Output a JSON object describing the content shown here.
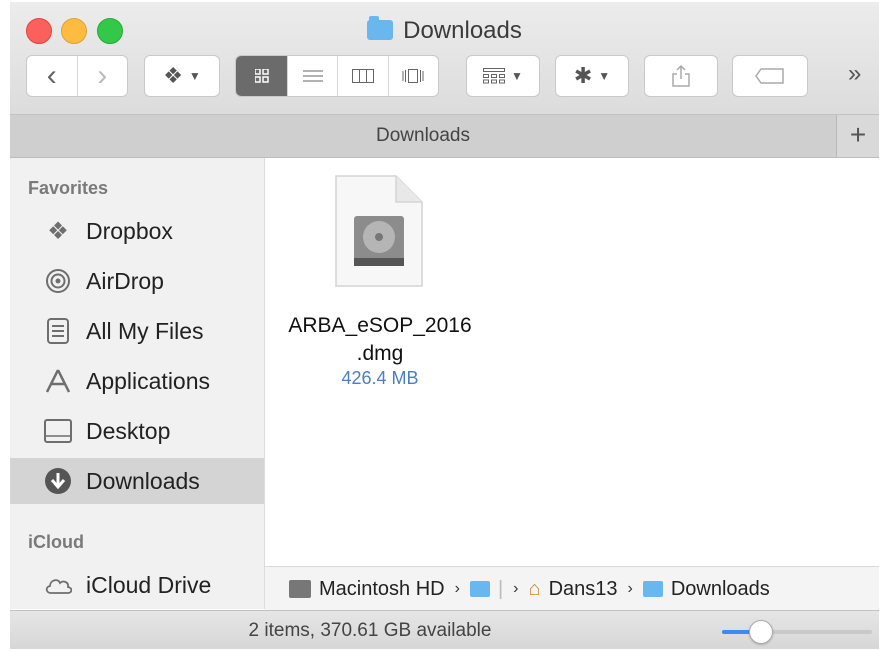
{
  "window": {
    "title": "Downloads",
    "title_icon": "folder-icon"
  },
  "toolbar": {
    "back_glyph": "‹",
    "forward_glyph": "›",
    "dropbox_glyph": "❖",
    "view_modes": [
      "icon-view",
      "list-view",
      "column-view",
      "cover-flow-view"
    ],
    "active_view": "icon-view",
    "overflow_glyph": "»"
  },
  "tabbar": {
    "tab_label": "Downloads",
    "new_tab_glyph": "+"
  },
  "sidebar": {
    "favorites_label": "Favorites",
    "favorites": [
      {
        "label": "Dropbox",
        "icon": "dropbox-icon"
      },
      {
        "label": "AirDrop",
        "icon": "airdrop-icon"
      },
      {
        "label": "All My Files",
        "icon": "all-files-icon"
      },
      {
        "label": "Applications",
        "icon": "applications-icon"
      },
      {
        "label": "Desktop",
        "icon": "desktop-icon"
      },
      {
        "label": "Downloads",
        "icon": "downloads-icon",
        "selected": true
      }
    ],
    "icloud_label": "iCloud",
    "icloud": [
      {
        "label": "iCloud Drive",
        "icon": "cloud-icon"
      }
    ]
  },
  "content": {
    "files": [
      {
        "name_line1": "ARBA_eSOP_2016",
        "name_line2": ".dmg",
        "size": "426.4 MB",
        "icon": "disk-image-icon"
      }
    ]
  },
  "pathbar": {
    "items": [
      {
        "label": "Macintosh HD",
        "icon": "hard-drive-icon"
      },
      {
        "label": "",
        "icon": "user-folder-icon"
      },
      {
        "label": "Dans13",
        "icon": "home-icon"
      },
      {
        "label": "Downloads",
        "icon": "folder-icon"
      }
    ]
  },
  "status": {
    "text": "2 items, 370.61 GB available",
    "icon_size_fraction": 0.25
  },
  "colors": {
    "accent": "#3d8af7",
    "selection": "#d4d4d4",
    "file_size": "#4a7fc1"
  }
}
